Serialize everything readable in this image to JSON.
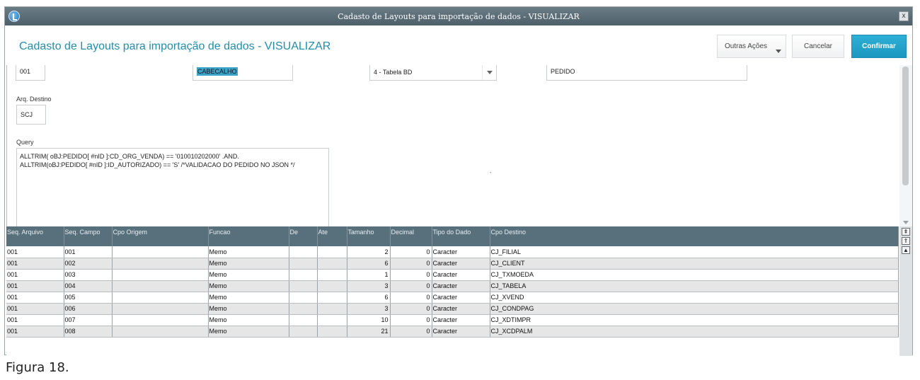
{
  "window": {
    "title": "Cadasto de Layouts para importação de dados - VISUALIZAR",
    "close_label": "x"
  },
  "header": {
    "title": "Cadasto de Layouts para importação de dados - VISUALIZAR",
    "buttons": {
      "outras_acoes": "Outras Ações",
      "cancelar": "Cancelar",
      "confirmar": "Confirmar"
    }
  },
  "form": {
    "seq_value": "001",
    "tipo_value": "CABECALHO",
    "origem_select": "4 - Tabela BD",
    "alias_value": "PEDIDO",
    "arq_destino_label": "Arq. Destino",
    "arq_destino_value": "SCJ",
    "query_label": "Query",
    "query_line1": "ALLTRIM( oBJ:PEDIDO[ #nID ]:CD_ORG_VENDA) == '010010202000'  .AND.",
    "query_line2": "ALLTRIM(oBJ:PEDIDO[ #nID ]:ID_AUTORIZADO) == 'S' /*VALIDACAO DO PEDIDO NO JSON */",
    "stray_dot": "."
  },
  "grid": {
    "columns": [
      "Seq. Arquivo",
      "Seq. Campo",
      "Cpo Origem",
      "Funcao",
      "De",
      "Ate",
      "Tamanho",
      "Decimal",
      "Tipo do Dado",
      "Cpo Destino"
    ],
    "rows": [
      [
        "001",
        "001",
        "",
        "Memo",
        "",
        "",
        "2",
        "0",
        "Caracter",
        "CJ_FILIAL"
      ],
      [
        "001",
        "002",
        "",
        "Memo",
        "",
        "",
        "6",
        "0",
        "Caracter",
        "CJ_CLIENT"
      ],
      [
        "001",
        "003",
        "",
        "Memo",
        "",
        "",
        "1",
        "0",
        "Caracter",
        "CJ_TXMOEDA"
      ],
      [
        "001",
        "004",
        "",
        "Memo",
        "",
        "",
        "3",
        "0",
        "Caracter",
        "CJ_TABELA"
      ],
      [
        "001",
        "005",
        "",
        "Memo",
        "",
        "",
        "6",
        "0",
        "Caracter",
        "CJ_XVEND"
      ],
      [
        "001",
        "006",
        "",
        "Memo",
        "",
        "",
        "3",
        "0",
        "Caracter",
        "CJ_CONDPAG"
      ],
      [
        "001",
        "007",
        "",
        "Memo",
        "",
        "",
        "10",
        "0",
        "Caracter",
        "CJ_XDTIMPR"
      ],
      [
        "001",
        "008",
        "",
        "Memo",
        "",
        "",
        "21",
        "0",
        "Caracter",
        "CJ_XCDPALM"
      ]
    ],
    "side_buttons": [
      "⇞",
      "⇑",
      "▲"
    ]
  },
  "caption": "Figura 18.",
  "colors": {
    "title_accent": "#1e8fb0",
    "confirm_button": "#1b97c0",
    "grid_header": "#58707c",
    "selection": "#3aa5c7"
  }
}
